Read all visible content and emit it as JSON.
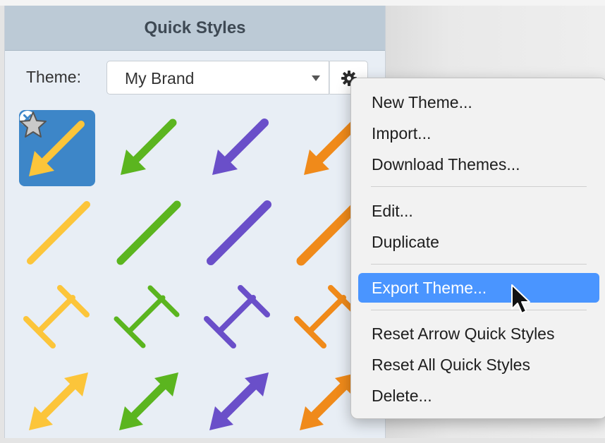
{
  "panel": {
    "title": "Quick Styles"
  },
  "theme": {
    "label": "Theme:",
    "selected": "My Brand"
  },
  "colors": {
    "yellow": "#fcc53a",
    "green": "#5bb51f",
    "purple": "#6a4fc9",
    "orange": "#f08a1a",
    "selected_bg": "#3d86c8",
    "menu_highlight": "#4a95ff"
  },
  "styles": {
    "rows": [
      "arrow",
      "line",
      "dimension",
      "double-arrow"
    ],
    "colors": [
      "yellow",
      "green",
      "purple",
      "orange"
    ],
    "selected": "yellow arrow (favorite)"
  },
  "menu": {
    "items": [
      {
        "label": "New Theme..."
      },
      {
        "label": "Import..."
      },
      {
        "label": "Download Themes..."
      },
      {
        "label": "Edit..."
      },
      {
        "label": "Duplicate"
      },
      {
        "label": "Export Theme...",
        "highlighted": true
      },
      {
        "label": "Reset Arrow Quick Styles"
      },
      {
        "label": "Reset All Quick Styles"
      },
      {
        "label": "Delete..."
      }
    ]
  }
}
